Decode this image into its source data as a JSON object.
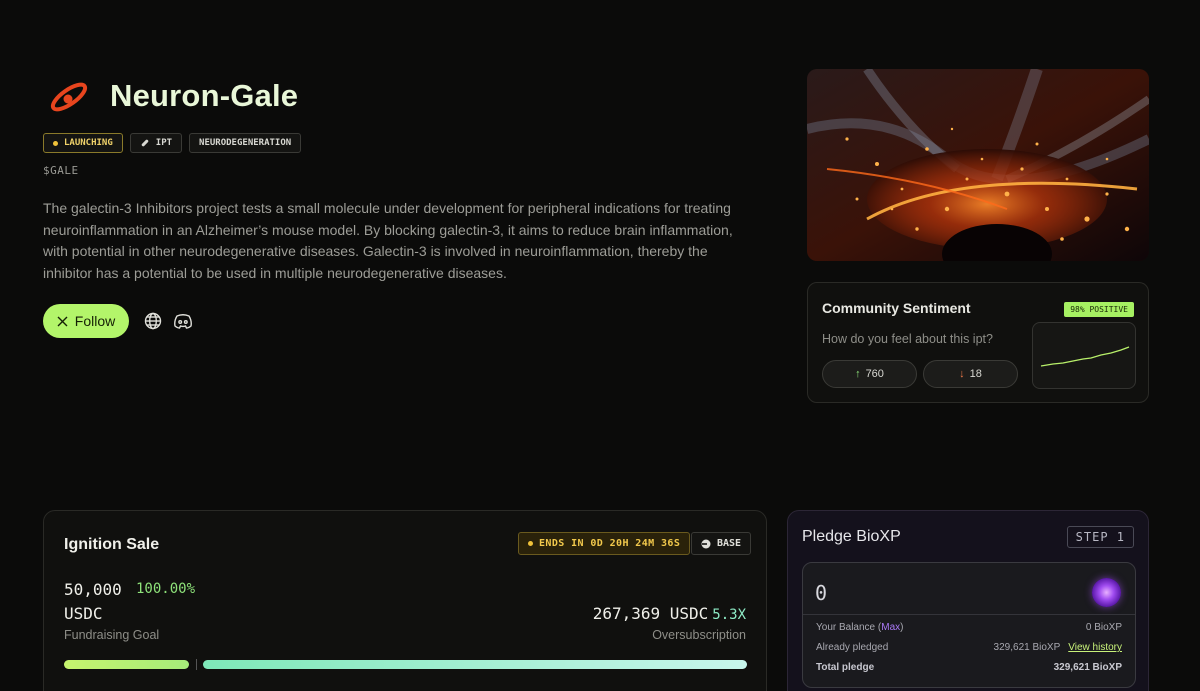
{
  "project": {
    "name": "Neuron-Gale",
    "ticker": "$GALE",
    "tags": [
      "LAUNCHING",
      "IPT",
      "NEURODEGENERATION"
    ],
    "description": "The galectin-3 Inhibitors project tests a small molecule under development for peripheral indications for treating neuroinflammation in an Alzheimer’s mouse model. By blocking galectin-3, it aims to reduce brain inflammation, with potential in other neurodegenerative diseases. Galectin-3 is involved in neuroinflammation, thereby the inhibitor has a potential to be used in multiple neurodegenerative diseases.",
    "follow_label": "Follow",
    "follow_icon": "x-logo-icon",
    "links": [
      "globe-icon",
      "discord-icon"
    ]
  },
  "sentiment": {
    "title": "Community Sentiment",
    "positive_badge": "98% POSITIVE",
    "question": "How do you feel about this ipt?",
    "up_count": "760",
    "down_count": "18",
    "up_arrow": "↑",
    "down_arrow": "↓"
  },
  "sale": {
    "title": "Ignition Sale",
    "ends": "ENDS IN 0D 20H 24M 36S",
    "chain": "BASE",
    "goal_amount": "50,000",
    "goal_pct": "100.00%",
    "goal_currency": "USDC",
    "goal_label": "Fundraising Goal",
    "raised": "267,369 USDC",
    "multiplier": "5.3X",
    "over_label": "Oversubscription"
  },
  "pledge": {
    "title": "Pledge BioXP",
    "step": "STEP 1",
    "amount_value": "0",
    "balance_label": "Your Balance (",
    "max_label": "Max",
    "balance_close": ")",
    "balance_value": "0 BioXP",
    "already_label": "Already pledged",
    "already_value": "329,621 BioXP",
    "history_label": "View history",
    "total_label": "Total pledge",
    "total_value": "329,621 BioXP"
  },
  "colors": {
    "accent_green": "#b3f56a",
    "launch_yellow": "#f2c94c",
    "bioxp_purple": "#a04cf0"
  }
}
